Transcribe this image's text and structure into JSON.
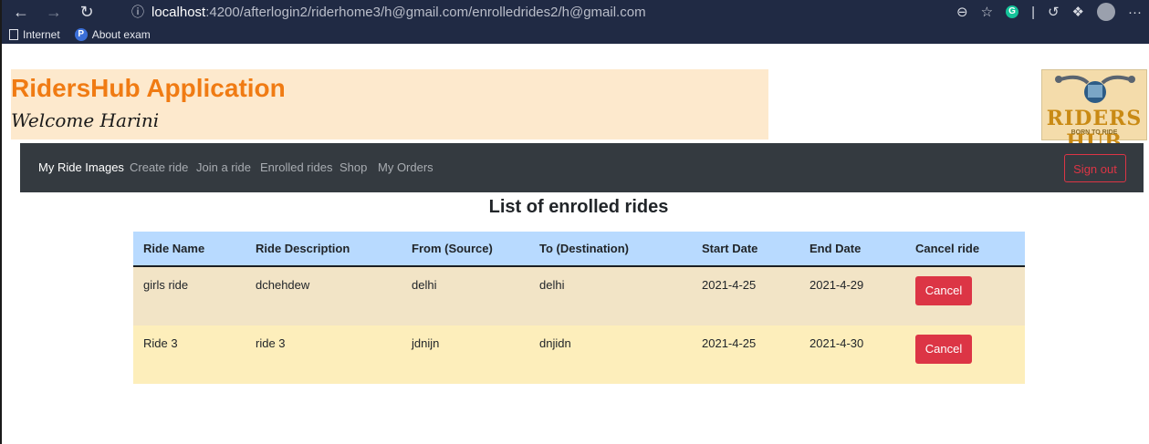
{
  "browser": {
    "url_host": "localhost",
    "url_rest": ":4200/afterlogin2/riderhome3/h@gmail.com/enrolledrides2/h@gmail.com",
    "favorites": [
      {
        "label": "Internet"
      },
      {
        "label": "About exam"
      }
    ],
    "more_label": "···"
  },
  "app": {
    "title": "RidersHub Application",
    "welcome": "Welcome Harini",
    "logo_text": "RIDERS HUB",
    "logo_sub": "BORN TO RIDE"
  },
  "nav": {
    "items": [
      "My Ride Images",
      "Create ride",
      "Join a ride",
      "Enrolled rides",
      "Shop",
      "My Orders"
    ],
    "signout_label": "Sign out"
  },
  "page": {
    "heading": "List of enrolled rides"
  },
  "table": {
    "headers": [
      "Ride Name",
      "Ride Description",
      "From (Source)",
      "To (Destination)",
      "Start Date",
      "End Date",
      "Cancel ride"
    ],
    "rows": [
      {
        "name": "girls ride",
        "description": "dchehdew",
        "from": "delhi",
        "to": "delhi",
        "start": "2021-4-25",
        "end": "2021-4-29",
        "action": "Cancel"
      },
      {
        "name": "Ride 3",
        "description": "ride 3",
        "from": "jdnijn",
        "to": "dnjidn",
        "start": "2021-4-25",
        "end": "2021-4-30",
        "action": "Cancel"
      }
    ]
  },
  "colors": {
    "brand_orange": "#f07b13",
    "navbar": "#343a40",
    "danger": "#dc3545",
    "table_header": "#b8daff"
  }
}
